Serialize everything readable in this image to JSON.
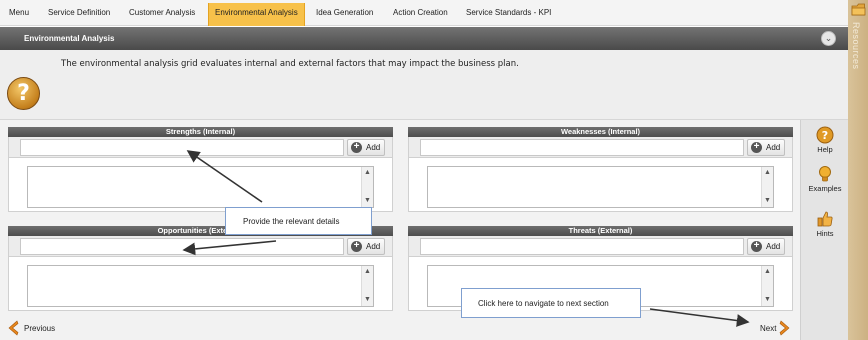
{
  "topnav": {
    "tabs": [
      {
        "label": "Menu"
      },
      {
        "label": "Service Definition"
      },
      {
        "label": "Customer Analysis"
      },
      {
        "label": "Environmental Analysis",
        "active": true
      },
      {
        "label": "Idea Generation"
      },
      {
        "label": "Action Creation"
      },
      {
        "label": "Service Standards - KPI"
      }
    ]
  },
  "resources": {
    "label": "Resources",
    "icon": "folder-icon"
  },
  "section": {
    "title": "Environmental Analysis",
    "collapse_icon": "chevron-down-icon"
  },
  "intro": {
    "icon": "question-icon",
    "text": "The environmental analysis grid evaluates internal and external factors that may impact the business plan."
  },
  "panels": [
    {
      "title": "Strengths (Internal)",
      "add_label": "Add",
      "input_value": ""
    },
    {
      "title": "Weaknesses (Internal)",
      "add_label": "Add",
      "input_value": ""
    },
    {
      "title": "Opportunities (External)",
      "add_label": "Add",
      "input_value": ""
    },
    {
      "title": "Threats (External)",
      "add_label": "Add",
      "input_value": ""
    }
  ],
  "rightrail": {
    "help": "Help",
    "examples": "Examples",
    "hints": "Hints"
  },
  "footer": {
    "previous": "Previous",
    "next": "Next"
  },
  "callouts": {
    "details": "Provide the relevant details",
    "navigate": "Click here to navigate to next section"
  },
  "colors": {
    "active_tab": "#f7c14a",
    "header_bar": "#5a5a5a",
    "accent_orange": "#e8871e",
    "callout_border": "#7f9fcf"
  }
}
